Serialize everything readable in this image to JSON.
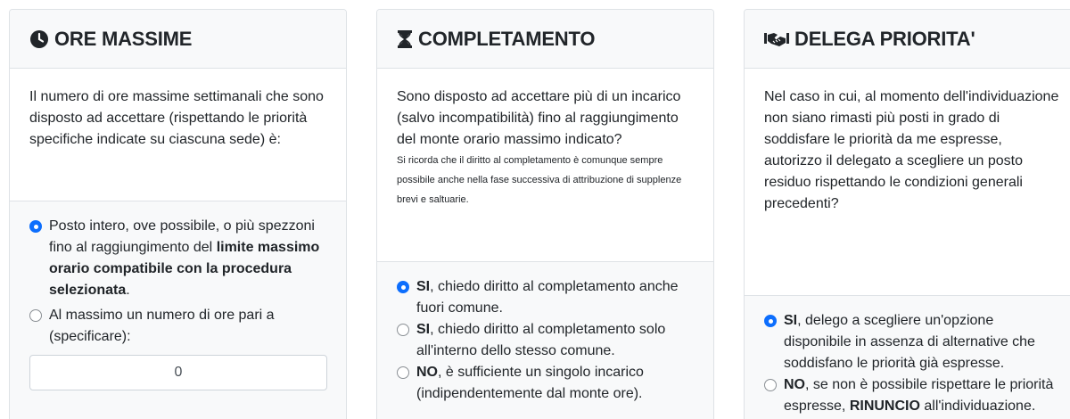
{
  "card1": {
    "title": "ORE MASSIME",
    "icon": "clock-icon",
    "body_text": "Il numero di ore massime settimanali che sono disposto ad accettare (rispettando le priorità specifiche indicate su ciascuna sede) è:",
    "option1": {
      "text_before": "Posto intero, ove possibile, o più spezzoni fino al raggiungimento del ",
      "bold": "limite massimo orario compatibile con la procedura selezionata",
      "text_after": ".",
      "checked": true
    },
    "option2": {
      "text": "Al massimo un numero di ore pari a (specificare):",
      "checked": false
    },
    "hours_input_value": "0"
  },
  "card2": {
    "title": "COMPLETAMENTO",
    "icon": "hourglass-icon",
    "body_text": "Sono disposto ad accettare più di un incarico (salvo incompatibilità) fino al raggiungimento del monte orario massimo indicato?",
    "note": "Si ricorda che il diritto al completamento è comunque sempre possibile anche nella fase successiva di attribuzione di supplenze brevi e saltuarie.",
    "option1": {
      "bold": "SI",
      "text": ", chiedo diritto al completamento anche fuori comune.",
      "checked": true
    },
    "option2": {
      "bold": "SI",
      "text": ", chiedo diritto al completamento solo all'interno dello stesso comune.",
      "checked": false
    },
    "option3": {
      "bold": "NO",
      "text": ", è sufficiente un singolo incarico (indipendentemente dal monte ore).",
      "checked": false
    }
  },
  "card3": {
    "title": "DELEGA PRIORITA'",
    "icon": "handshake-icon",
    "body_text": "Nel caso in cui, al momento dell'individuazione non siano rimasti più posti in grado di soddisfare le priorità da me espresse, autorizzo il delegato a scegliere un posto residuo rispettando le condizioni generali precedenti?",
    "option1": {
      "bold": "SI",
      "text": ", delego a scegliere un'opzione disponibile in assenza di alternative che soddisfano le priorità già espresse.",
      "checked": true
    },
    "option2": {
      "bold_start": "NO",
      "text_mid": ", se non è possibile rispettare le priorità espresse, ",
      "bold_mid": "RINUNCIO",
      "text_end": " all'individuazione.",
      "checked": false
    }
  }
}
